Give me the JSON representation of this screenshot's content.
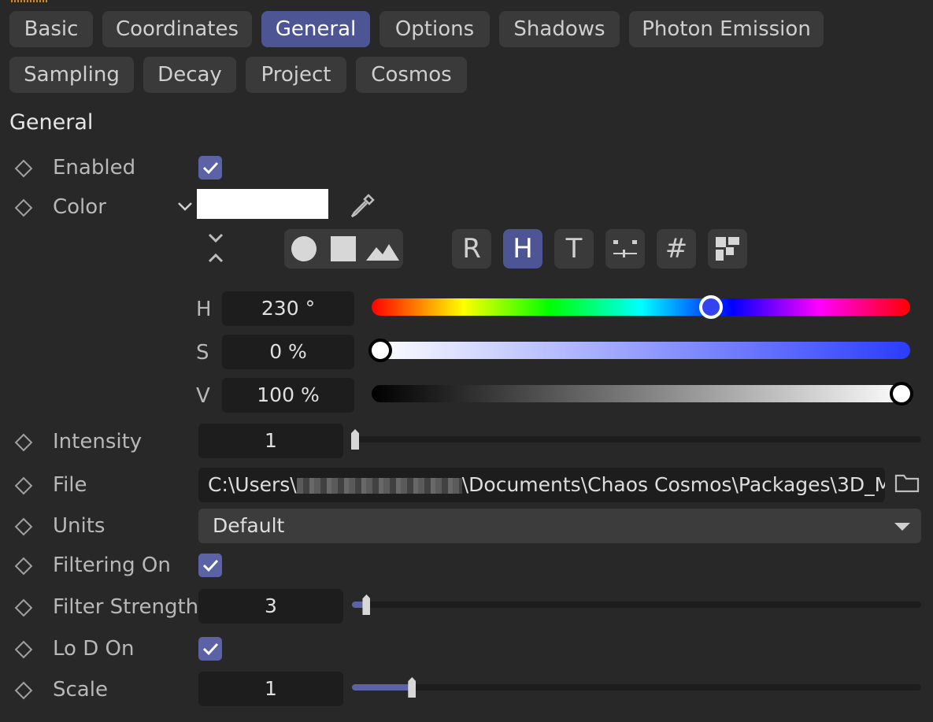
{
  "tabs_row1": [
    {
      "label": "Basic"
    },
    {
      "label": "Coordinates"
    },
    {
      "label": "General",
      "active": true
    },
    {
      "label": "Options"
    },
    {
      "label": "Shadows"
    },
    {
      "label": "Photon Emission"
    }
  ],
  "tabs_row2": [
    {
      "label": "Sampling"
    },
    {
      "label": "Decay"
    },
    {
      "label": "Project"
    },
    {
      "label": "Cosmos"
    }
  ],
  "section_title": "General",
  "rows": {
    "enabled": {
      "label": "Enabled",
      "checked": true
    },
    "color": {
      "label": "Color",
      "swatch": "#ffffff"
    },
    "intensity": {
      "label": "Intensity",
      "value": "1",
      "slider_fraction": 0.0
    },
    "file": {
      "label": "File",
      "path_prefix": "C:\\Users\\",
      "path_suffix": "\\Documents\\Chaos Cosmos\\Packages\\3D_M"
    },
    "units": {
      "label": "Units",
      "value": "Default"
    },
    "filtering_on": {
      "label": "Filtering On",
      "checked": true
    },
    "filter_strength": {
      "label": "Filter Strength",
      "value": "3",
      "slider_fraction": 0.02
    },
    "lod_on": {
      "label": "Lo D On",
      "checked": true
    },
    "scale": {
      "label": "Scale",
      "value": "1",
      "slider_fraction": 0.1
    }
  },
  "color_picker": {
    "modes": [
      "R",
      "H",
      "T",
      "⚍",
      "#",
      "▦"
    ],
    "active_mode": "H",
    "hsv": {
      "h_label": "H",
      "h_value": "230 °",
      "h_fraction": 0.63,
      "s_label": "S",
      "s_value": "0 %",
      "s_fraction": 0.0,
      "v_label": "V",
      "v_value": "100 %",
      "v_fraction": 1.0
    }
  },
  "colors": {
    "accent": "#5b62a6",
    "panel": "#282828",
    "field": "#1d1d1d",
    "tab": "#3a3a3a"
  },
  "icons": [
    "diamond-keyframe-icon",
    "chevron-down-icon",
    "eyedropper-icon",
    "expand-collapse-icon",
    "circle-icon",
    "square-icon",
    "image-icon",
    "folder-icon",
    "checkmark-icon",
    "dropdown-arrow-icon"
  ]
}
